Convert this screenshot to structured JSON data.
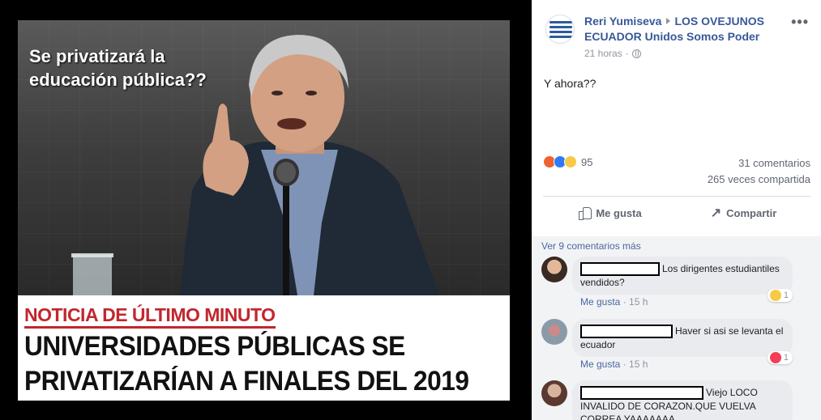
{
  "image": {
    "question_text": "Se privatizará la educación pública??",
    "kicker": "NOTICIA DE ÚLTIMO MINUTO",
    "headline_line1": "UNIVERSIDADES  PÚBLICAS SE",
    "headline_line2": "PRIVATIZARÍAN A FINALES DEL 2019"
  },
  "post": {
    "author": "Reri Yumiseva",
    "group": "LOS OVEJUNOS ECUADOR Unidos Somos Poder",
    "time": "21 horas",
    "privacy_icon": "globe-icon",
    "text": "Y ahora??",
    "reaction_count": "95",
    "comments_count": "31 comentarios",
    "shares_count": "265 veces compartida",
    "like_label": "Me gusta",
    "share_label": "Compartir"
  },
  "comments": {
    "view_more": "Ver 9 comentarios más",
    "items": [
      {
        "text": "Los dirigentes estudiantiles vendidos?",
        "like_label": "Me gusta",
        "time": "15 h",
        "reaction_count": "1",
        "reaction_type": "wow"
      },
      {
        "text": "Haver si asi se levanta el ecuador",
        "like_label": "Me gusta",
        "time": "15 h",
        "reaction_count": "1",
        "reaction_type": "love"
      },
      {
        "text": "Viejo LOCO INVALIDO DE CORAZON.QUE VUELVA CORREA YAAAAAAA"
      }
    ]
  },
  "colors": {
    "link_blue": "#385898",
    "kicker_red": "#c1272d",
    "like_blue": "#2f7bf5",
    "angry_orange": "#f0622f",
    "wow_yellow": "#f7c947",
    "love_red": "#f33e58"
  }
}
